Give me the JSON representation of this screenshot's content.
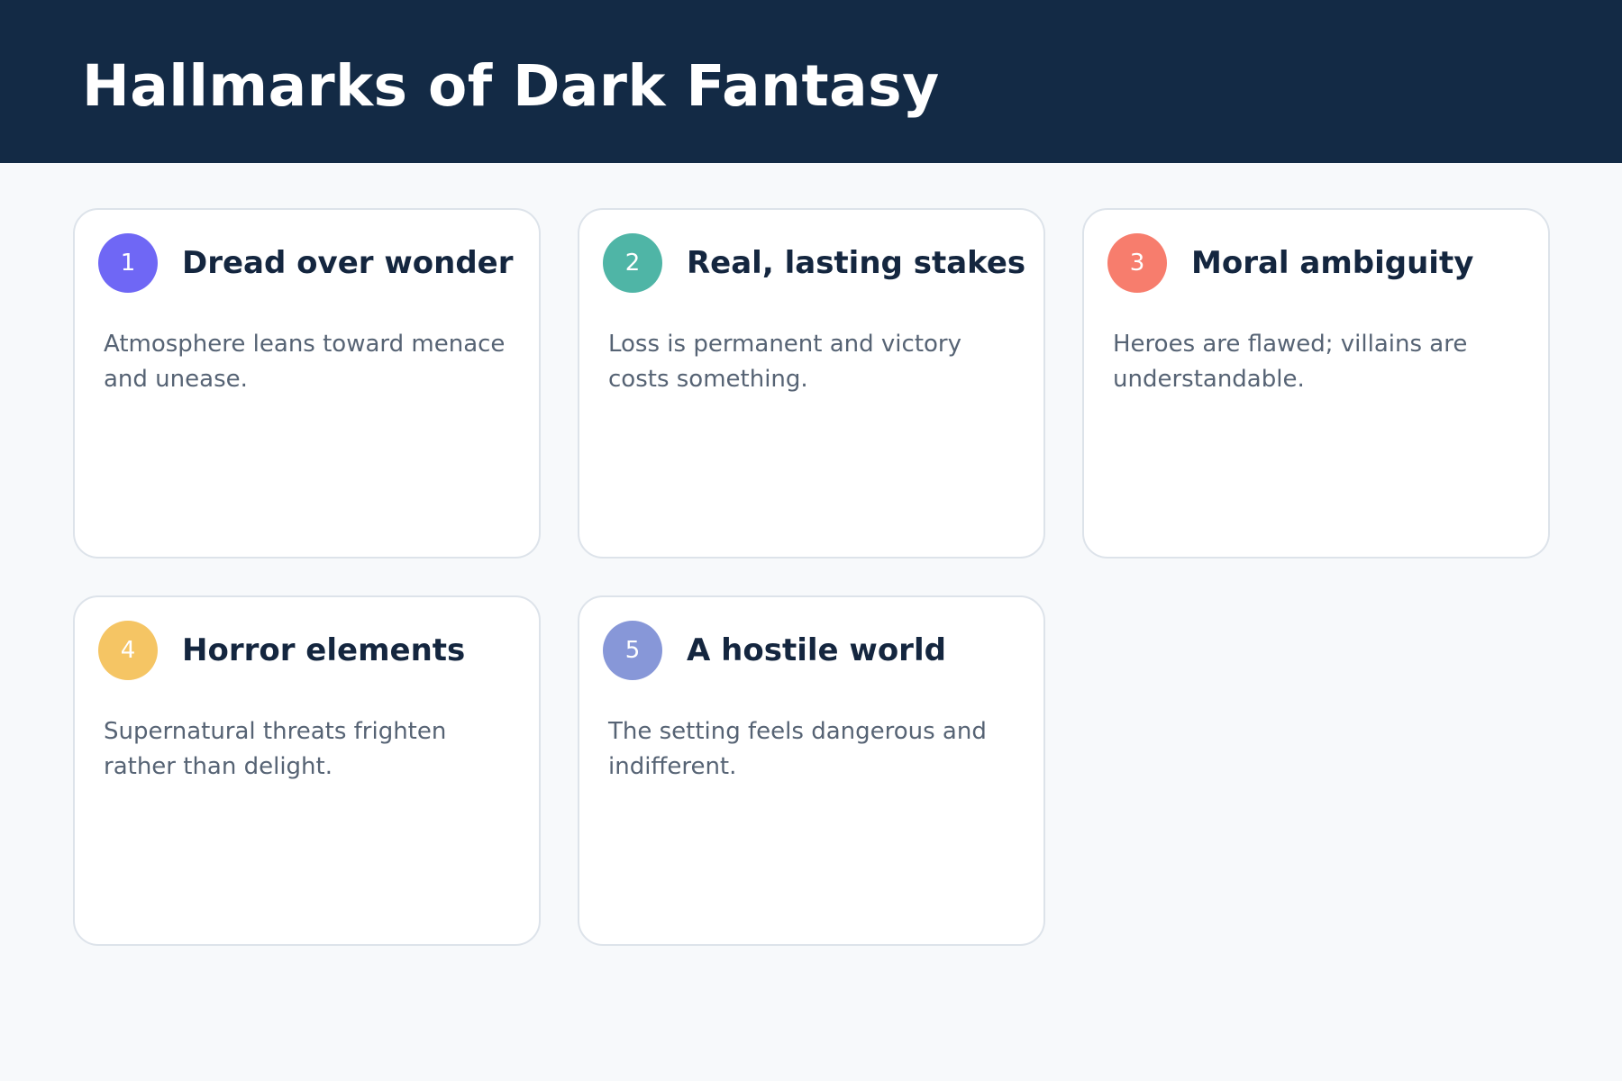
{
  "page": {
    "title": "Hallmarks of Dark Fantasy"
  },
  "colors": {
    "header_bg": "#132a45",
    "page_bg": "#f7f9fb",
    "card_border": "#dde3ea",
    "title_text": "#14263f",
    "body_text": "#566374"
  },
  "cards": [
    {
      "number": "1",
      "title": "Dread over wonder",
      "description": "Atmosphere leans toward menace and unease.",
      "badge_color": "#6f67f5"
    },
    {
      "number": "2",
      "title": "Real, lasting stakes",
      "description": "Loss is permanent and victory costs something.",
      "badge_color": "#4fb5a6"
    },
    {
      "number": "3",
      "title": "Moral ambiguity",
      "description": "Heroes are flawed; villains are understandable.",
      "badge_color": "#f77d6d"
    },
    {
      "number": "4",
      "title": "Horror elements",
      "description": "Supernatural threats frighten rather than delight.",
      "badge_color": "#f5c564"
    },
    {
      "number": "5",
      "title": "A hostile world",
      "description": "The setting feels dangerous and indifferent.",
      "badge_color": "#8797d8"
    }
  ]
}
